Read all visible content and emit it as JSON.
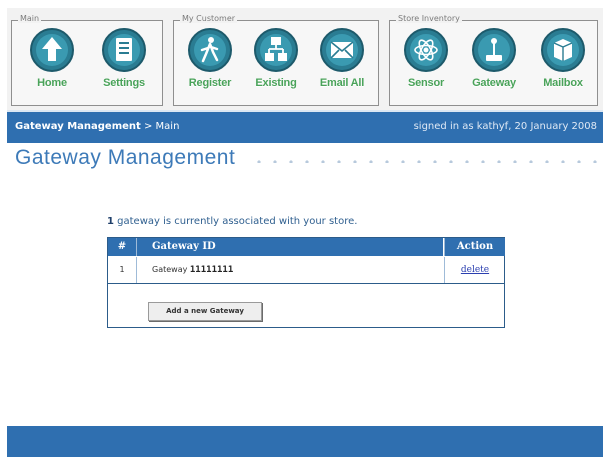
{
  "nav": {
    "groups": [
      {
        "legend": "Main",
        "items": [
          {
            "label": "Home",
            "icon": "home-icon"
          },
          {
            "label": "Settings",
            "icon": "settings-icon"
          }
        ]
      },
      {
        "legend": "My Customer",
        "items": [
          {
            "label": "Register",
            "icon": "register-icon"
          },
          {
            "label": "Existing",
            "icon": "existing-icon"
          },
          {
            "label": "Email All",
            "icon": "email-icon"
          }
        ]
      },
      {
        "legend": "Store Inventory",
        "items": [
          {
            "label": "Sensor",
            "icon": "sensor-icon"
          },
          {
            "label": "Gateway",
            "icon": "gateway-icon"
          },
          {
            "label": "Mailbox",
            "icon": "mailbox-icon"
          }
        ]
      }
    ]
  },
  "status": {
    "crumb_bold": "Gateway Management",
    "crumb_rest": " > Main",
    "signed_in": "signed in as kathyf, 20 January 2008"
  },
  "page": {
    "title": "Gateway Management",
    "info_count": "1",
    "info_text": " gateway is currently associated with your store."
  },
  "table": {
    "headers": {
      "num": "#",
      "gateway_id": "Gateway ID",
      "action": "Action"
    },
    "rows": [
      {
        "num": "1",
        "prefix": "Gateway ",
        "id": "11111111",
        "action": "delete"
      }
    ],
    "add_button": "Add a new Gateway"
  },
  "colors": {
    "brand_blue": "#2f6fb0",
    "icon_teal": "#2a7c92",
    "label_green": "#4aa35a",
    "title_blue": "#3d7ab8"
  }
}
